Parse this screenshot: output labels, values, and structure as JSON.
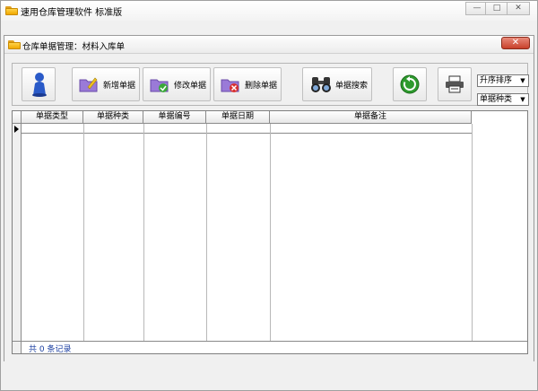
{
  "window": {
    "title": "速用仓库管理软件 标准版",
    "controls": {
      "minimize": "—",
      "maximize": "□",
      "close": "✕"
    }
  },
  "inner_window": {
    "title": "仓库单据管理：材料入库单",
    "close": "✕"
  },
  "toolbar": {
    "user_icon": "user-figure-icon",
    "add_label": "新增单据",
    "edit_label": "修改单据",
    "delete_label": "删除单据",
    "search_label": "单据搜索",
    "refresh_icon": "refresh-icon",
    "print_icon": "printer-icon",
    "sort_select": "升序排序",
    "type_select": "单据种类"
  },
  "grid": {
    "columns": [
      "单据类型",
      "单据种类",
      "单据编号",
      "单据日期",
      "单据备注"
    ],
    "rows": [],
    "footer": "共 0 条记录"
  },
  "colors": {
    "footer_text": "#1a3ea0",
    "close_red": "#c8402a",
    "refresh_green": "#2e9a2e",
    "user_blue": "#2a5ac8"
  }
}
